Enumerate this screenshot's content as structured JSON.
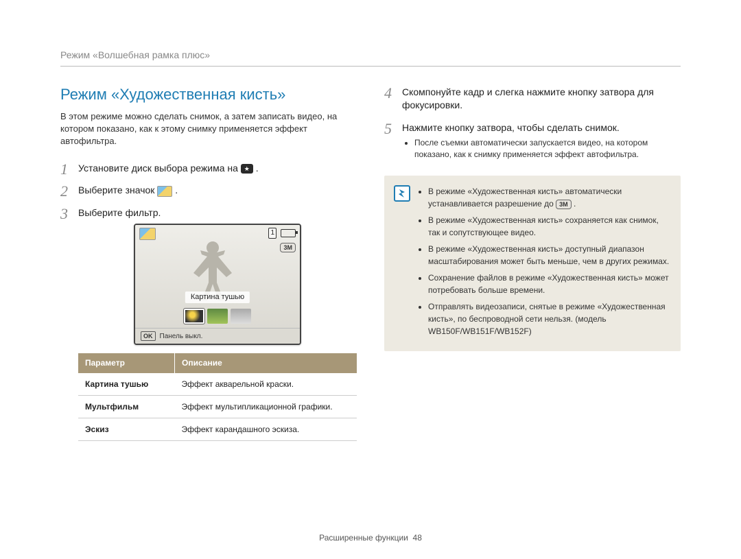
{
  "header": {
    "breadcrumb": "Режим «Волшебная рамка плюс»"
  },
  "left": {
    "title": "Режим «Художественная кисть»",
    "intro": "В этом режиме можно сделать снимок, а затем записать видео, на котором показано, как к этому снимку применяется эффект автофильтра.",
    "steps": {
      "s1a": "Установите диск выбора режима на ",
      "s1b": ".",
      "s2a": "Выберите значок ",
      "s2b": ".",
      "s3": "Выберите фильтр."
    },
    "camera": {
      "count": "1",
      "caption": "Картина тушью",
      "ok": "OK",
      "panel": "Панель выкл.",
      "resBadge": "3M"
    },
    "table": {
      "h1": "Параметр",
      "h2": "Описание",
      "rows": [
        {
          "name": "Картина тушью",
          "desc": "Эффект акварельной краски."
        },
        {
          "name": "Мультфильм",
          "desc": "Эффект мультипликационной графики."
        },
        {
          "name": "Эскиз",
          "desc": "Эффект карандашного эскиза."
        }
      ]
    }
  },
  "right": {
    "steps": {
      "s4": "Скомпонуйте кадр и слегка нажмите кнопку затвора для фокусировки.",
      "s5": "Нажмите кнопку затвора, чтобы сделать снимок.",
      "s5_sub1": "После съемки автоматически запускается видео, на котором показано, как к снимку применяется эффект автофильтра."
    },
    "note": {
      "resBadge": "3M",
      "n1a": "В режиме «Художественная кисть» автоматически устанавливается разрешение до ",
      "n1b": ".",
      "n2": "В режиме «Художественная кисть» сохраняется как снимок, так и сопутствующее видео.",
      "n3": "В режиме «Художественная кисть» доступный диапазон масштабирования может быть меньше, чем в других режимах.",
      "n4": "Сохранение файлов в режиме «Художественная кисть» может потребовать больше времени.",
      "n5": "Отправлять видеозаписи, снятые в режиме «Художественная кисть», по беспроводной сети нельзя. (модель WB150F/WB151F/WB152F)"
    }
  },
  "footer": {
    "section": "Расширенные функции",
    "page": "48"
  }
}
